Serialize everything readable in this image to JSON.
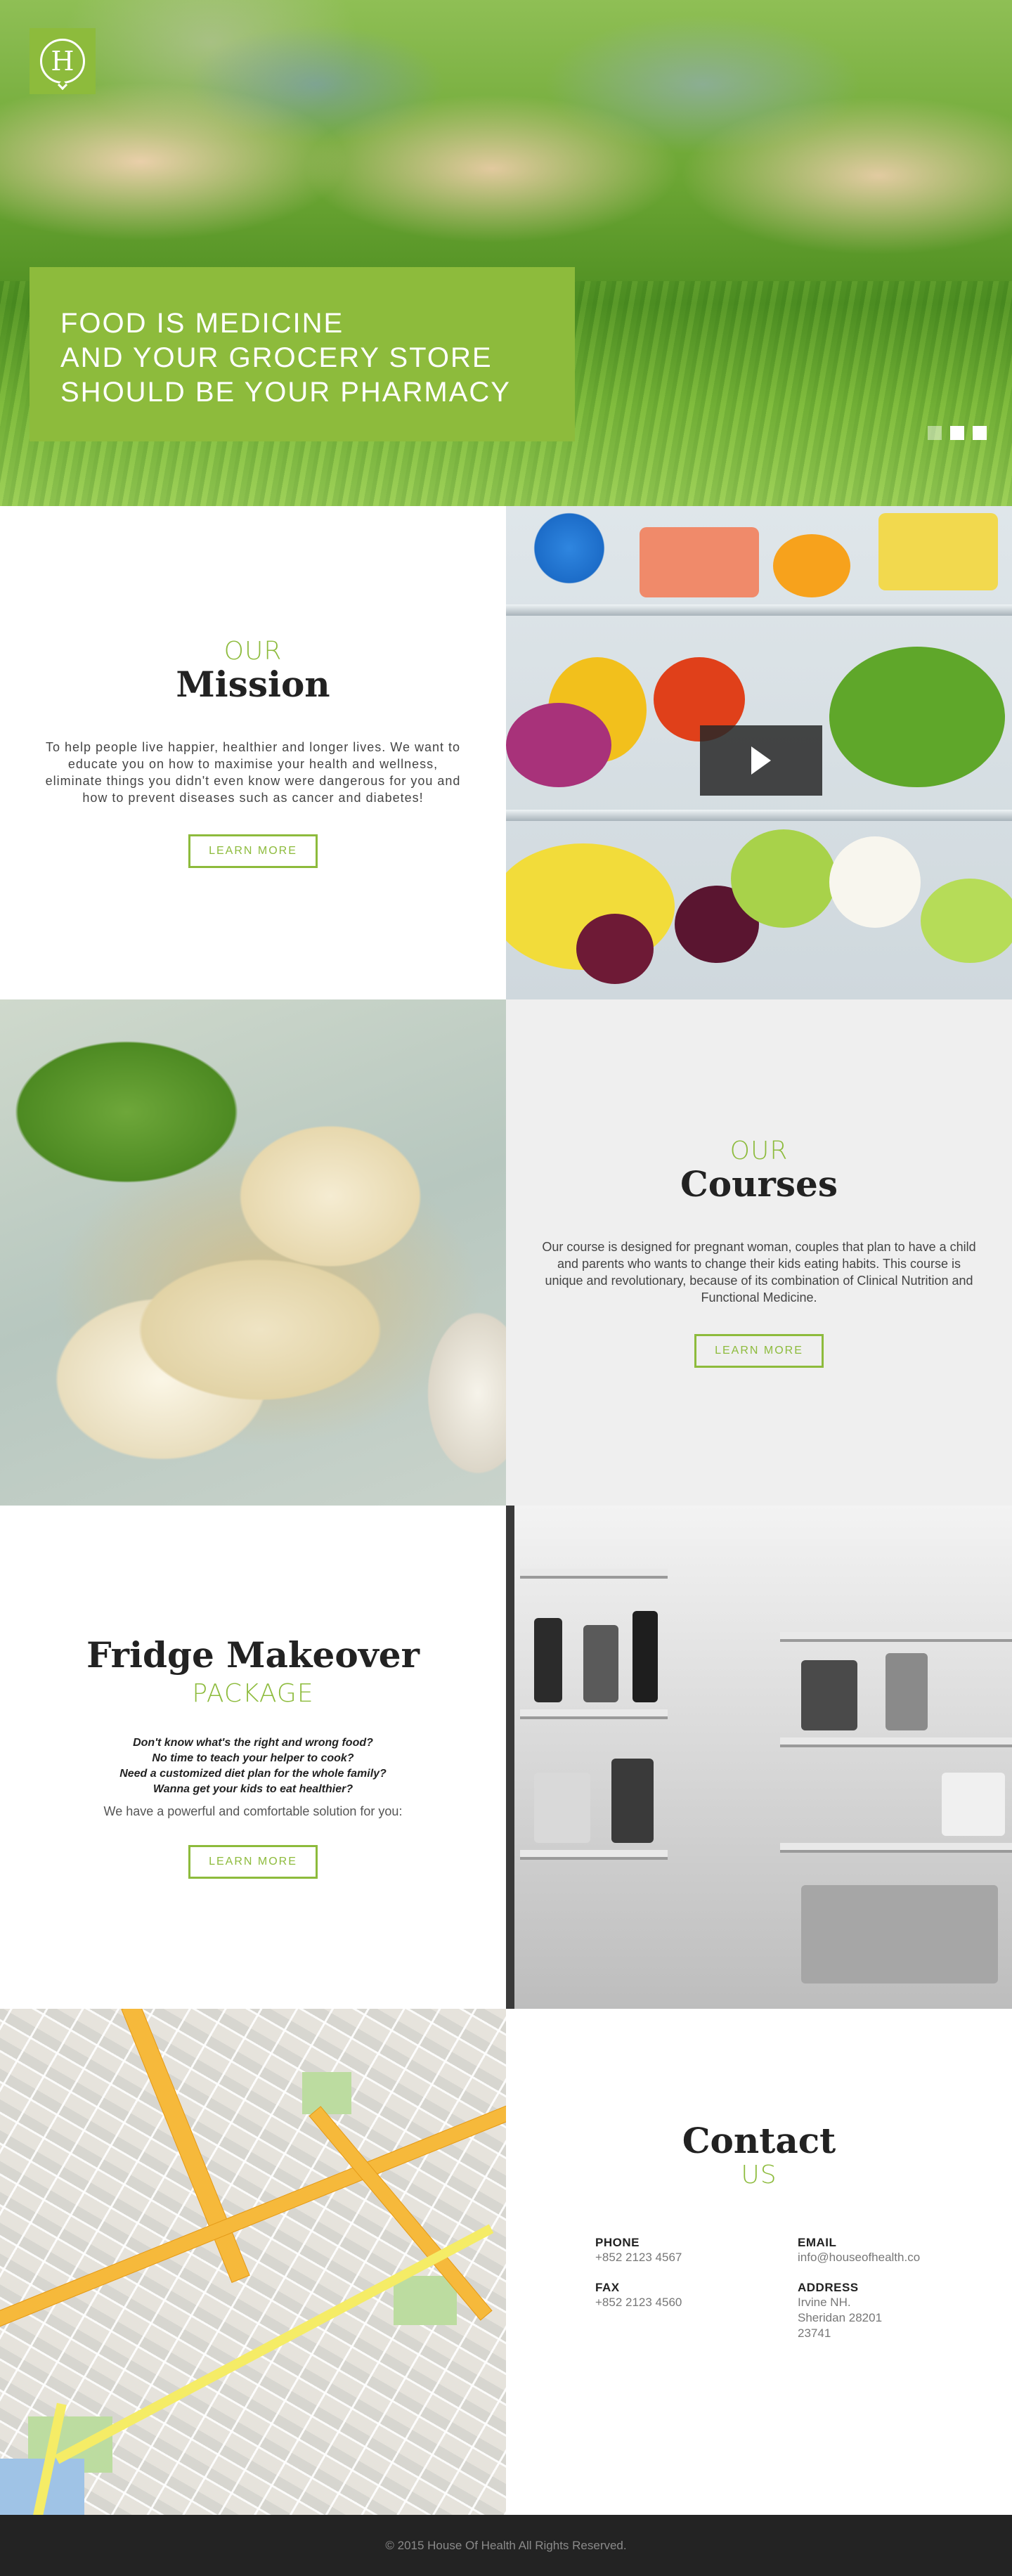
{
  "brand": {
    "logo_letter": "H"
  },
  "hero": {
    "lines": [
      "FOOD IS MEDICINE",
      "AND YOUR GROCERY STORE",
      "SHOULD BE YOUR PHARMACY"
    ],
    "slides": {
      "count": 3,
      "active_index": 2
    }
  },
  "mission": {
    "eyebrow": "OUR",
    "title": "Mission",
    "paragraph": "To help people live happier, healthier and longer lives. We want to educate you on how to maximise your health and wellness, eliminate things you didn't even know were dangerous for you and how to prevent diseases such as cancer and diabetes!",
    "button": "LEARN MORE",
    "video_icon": "play-icon"
  },
  "courses": {
    "eyebrow": "OUR",
    "title": "Courses",
    "paragraph": "Our course is designed for pregnant woman, couples that plan to have a child and parents who wants to change their kids eating habits. This course is unique and revolutionary, because of its combination of Clinical Nutrition and Functional Medicine.",
    "button": "LEARN MORE"
  },
  "makeover": {
    "title": "Fridge Makeover",
    "eyebrow": "PACKAGE",
    "questions": [
      "Don't know what's the right and wrong food?",
      "No time to teach your helper to cook?",
      "Need a customized diet plan for the whole family?",
      "Wanna get your kids to eat healthier?"
    ],
    "solution": "We have a powerful and comfortable solution for you:",
    "button": "LEARN MORE"
  },
  "contact": {
    "title": "Contact",
    "eyebrow": "US",
    "phone_label": "PHONE",
    "phone": "+852 2123 4567",
    "email_label": "EMAIL",
    "email": "info@houseofhealth.co",
    "fax_label": "FAX",
    "fax": "+852 2123 4560",
    "address_label": "ADDRESS",
    "address_lines": [
      "Irvine NH.",
      "Sheridan 28201",
      "23741"
    ]
  },
  "footer": {
    "copyright": "© 2015 House Of Health All Rights Reserved."
  },
  "colors": {
    "accent": "#8dbb3c",
    "dark": "#232323",
    "panel_grey": "#efefef"
  }
}
